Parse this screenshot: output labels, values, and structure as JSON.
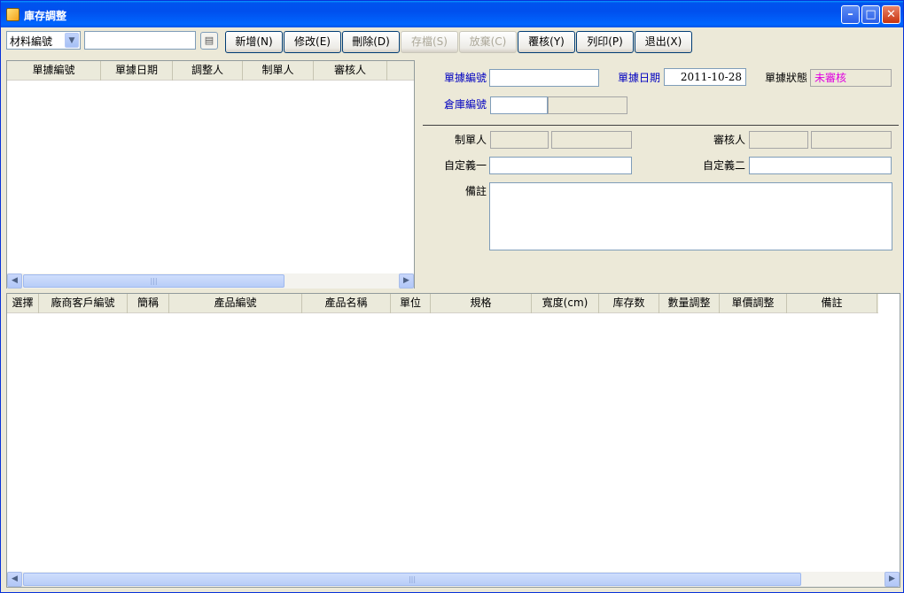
{
  "window": {
    "title": "庫存調整"
  },
  "toolbar": {
    "field_select": "材料編號",
    "search_value": "",
    "buttons": {
      "add": "新增(N)",
      "edit": "修改(E)",
      "delete": "刪除(D)",
      "save": "存檔(S)",
      "discard": "放棄(C)",
      "review": "覆核(Y)",
      "print": "列印(P)",
      "exit": "退出(X)"
    }
  },
  "list_grid": {
    "columns": [
      "單據編號",
      "單據日期",
      "調整人",
      "制單人",
      "審核人"
    ]
  },
  "form": {
    "doc_no_label": "單據編號",
    "doc_no_value": "",
    "doc_date_label": "單據日期",
    "doc_date_value": "2011-10-28",
    "status_label": "單據狀態",
    "status_value": "未審核",
    "warehouse_label": "倉庫編號",
    "maker_label": "制單人",
    "reviewer_label": "審核人",
    "custom1_label": "自定義一",
    "custom2_label": "自定義二",
    "remark_label": "備註"
  },
  "detail_grid": {
    "columns": [
      "選擇",
      "廠商客戶編號",
      "簡稱",
      "產品編號",
      "產品名稱",
      "單位",
      "規格",
      "寬度(cm)",
      "库存数",
      "數量調整",
      "單價調整",
      "備註"
    ]
  },
  "colors": {
    "accent": "#0050ee",
    "status": "#e000e0",
    "label_blue": "#0000c0"
  }
}
